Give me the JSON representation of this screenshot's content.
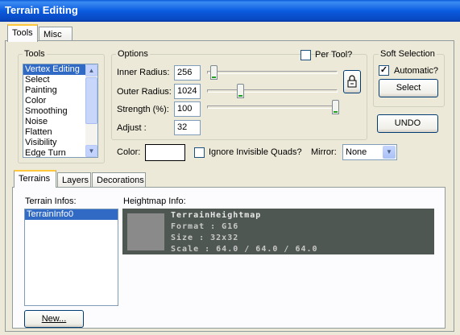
{
  "window": {
    "title": "Terrain Editing"
  },
  "top_tabs": [
    {
      "label": "Tools"
    },
    {
      "label": "Misc"
    }
  ],
  "tools": {
    "group_label": "Tools",
    "items": [
      "Vertex Editing",
      "Select",
      "Painting",
      "Color",
      "Smoothing",
      "Noise",
      "Flatten",
      "Visibility",
      "Edge Turn"
    ],
    "selected": "Vertex Editing"
  },
  "options": {
    "group_label": "Options",
    "per_tool_label": "Per Tool?",
    "per_tool_checked": false,
    "inner_radius": {
      "label": "Inner Radius:",
      "value": "256"
    },
    "outer_radius": {
      "label": "Outer Radius:",
      "value": "1024"
    },
    "strength": {
      "label": "Strength (%):",
      "value": "100"
    },
    "adjust": {
      "label": "Adjust :",
      "value": "32"
    }
  },
  "soft_selection": {
    "group_label": "Soft Selection",
    "automatic_label": "Automatic?",
    "automatic_checked": true,
    "select_label": "Select"
  },
  "undo_label": "UNDO",
  "color": {
    "label": "Color:",
    "value": "#ffffff"
  },
  "ignore_invisible": {
    "label": "Ignore Invisible Quads?",
    "checked": false
  },
  "mirror": {
    "label": "Mirror:",
    "value": "None"
  },
  "bottom_tabs": [
    {
      "label": "Terrains"
    },
    {
      "label": "Layers"
    },
    {
      "label": "Decorations"
    }
  ],
  "terrain_infos": {
    "label": "Terrain Infos:",
    "items": [
      "TerrainInfo0"
    ],
    "new_button": "New..."
  },
  "heightmap": {
    "label": "Heightmap Info:",
    "name": "TerrainHeightmap",
    "format": "Format  : G16",
    "size": "Size    : 32x32",
    "scale": "Scale : 64.0 / 64.0 / 64.0"
  }
}
